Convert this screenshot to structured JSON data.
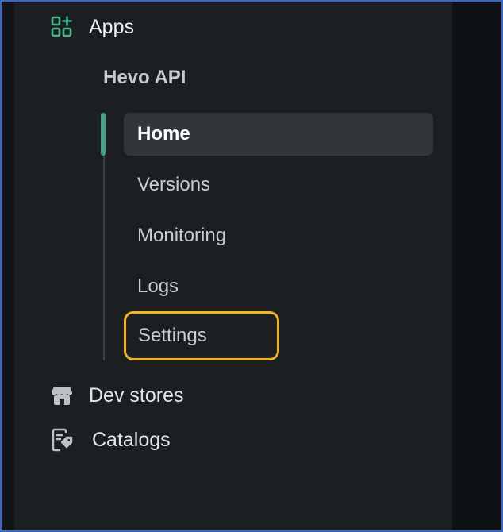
{
  "nav": {
    "apps_label": "Apps",
    "app_name": "Hevo API",
    "app_items": [
      {
        "label": "Home"
      },
      {
        "label": "Versions"
      },
      {
        "label": "Monitoring"
      },
      {
        "label": "Logs"
      },
      {
        "label": "Settings"
      }
    ],
    "dev_stores_label": "Dev stores",
    "catalogs_label": "Catalogs"
  },
  "icons": {
    "apps": "apps-grid-plus-icon",
    "dev_stores": "store-icon",
    "catalogs": "catalog-tag-icon"
  },
  "colors": {
    "accent": "#3fa383",
    "focus_ring": "#f2b322",
    "sidebar_bg": "#1b1f21",
    "active_bg": "#30363a"
  }
}
